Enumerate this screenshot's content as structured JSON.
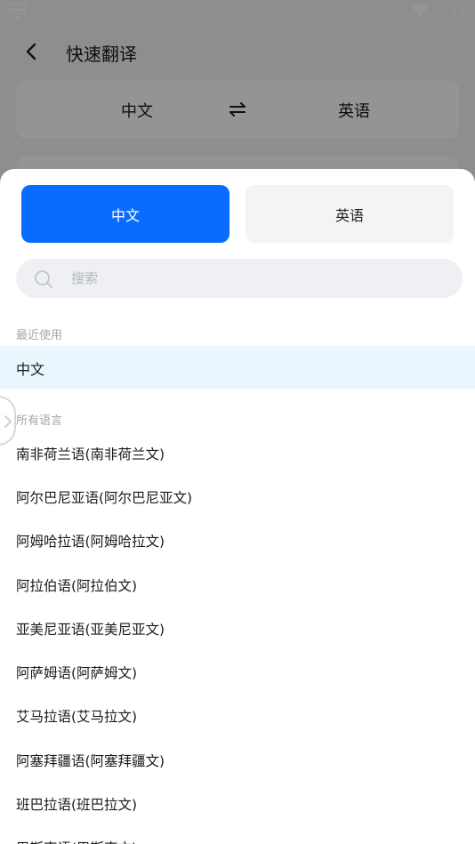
{
  "status_bar": {
    "time": "3:22",
    "left_icon": "storage-icon",
    "wifi_icon": "wifi-icon"
  },
  "nav": {
    "back_icon": "back-arrow-icon",
    "title": "快速翻译"
  },
  "lang_switch": {
    "source": "中文",
    "target": "英语",
    "swap_icon": "swap-arrows-icon"
  },
  "sheet": {
    "segment": {
      "left_label": "中文",
      "right_label": "英语",
      "active_color": "#0a6cff"
    },
    "search": {
      "placeholder": "搜索",
      "icon": "search-icon"
    },
    "recent_label": "最近使用",
    "recent_items": [
      "中文"
    ],
    "all_label": "所有语言",
    "languages": [
      "南非荷兰语(南非荷兰文)",
      "阿尔巴尼亚语(阿尔巴尼亚文)",
      "阿姆哈拉语(阿姆哈拉文)",
      "阿拉伯语(阿拉伯文)",
      "亚美尼亚语(亚美尼亚文)",
      "阿萨姆语(阿萨姆文)",
      "艾马拉语(艾马拉文)",
      "阿塞拜疆语(阿塞拜疆文)",
      "班巴拉语(班巴拉文)",
      "巴斯克语(巴斯克文)"
    ]
  }
}
